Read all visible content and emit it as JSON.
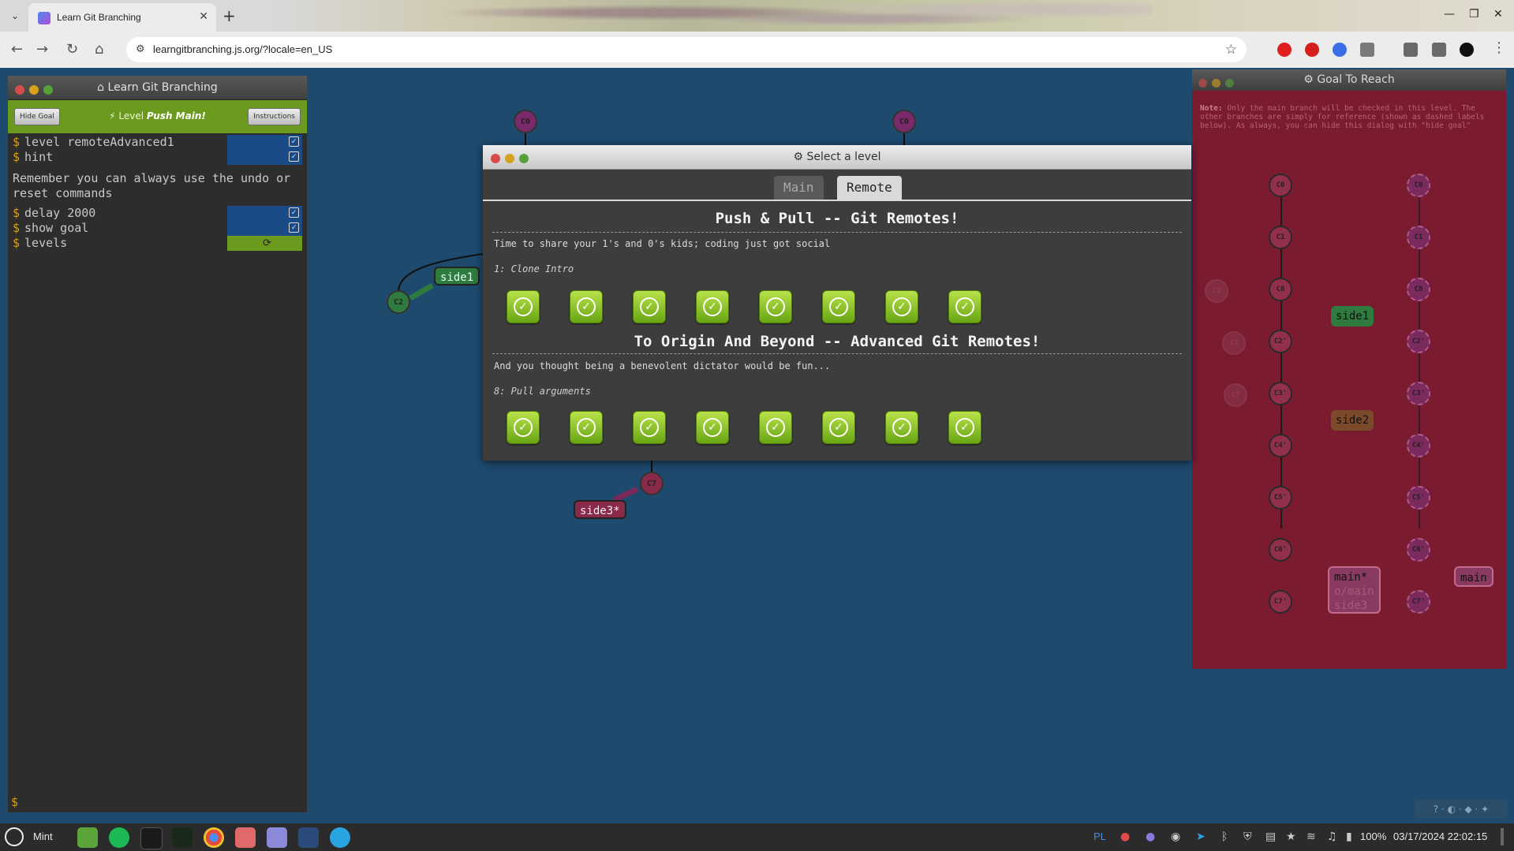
{
  "browser": {
    "tab_title": "Learn Git Branching",
    "tab_close": "✕",
    "new_tab": "+",
    "url": "learngitbranching.js.org/?locale=en_US",
    "nav": {
      "back": "←",
      "forward": "→",
      "reload": "↻",
      "home": "⌂"
    },
    "window": {
      "minimize": "—",
      "restore": "❐",
      "close": "✕"
    }
  },
  "terminal": {
    "title": "Learn Git Branching",
    "hide_goal_label": "Hide Goal",
    "instructions_label": "Instructions",
    "level_prefix": "Level",
    "level_name": "Push Main!",
    "commands": [
      {
        "text": "level remoteAdvanced1",
        "status": "done"
      },
      {
        "text": "hint",
        "status": "done"
      },
      {
        "text": "delay 2000",
        "status": "done"
      },
      {
        "text": "show goal",
        "status": "done"
      },
      {
        "text": "levels",
        "status": "running"
      }
    ],
    "message": "Remember you can always use the undo or reset commands",
    "prompt": "$",
    "dollar": "$",
    "check": "✓",
    "refresh": "⟳"
  },
  "graph": {
    "nodes": [
      {
        "id": "C0",
        "label": "C0"
      },
      {
        "id": "C0b",
        "label": "C0"
      },
      {
        "id": "C2",
        "label": "C2"
      },
      {
        "id": "C7",
        "label": "C7"
      }
    ],
    "branches": {
      "side1": "side1",
      "side3": "side3*"
    }
  },
  "goal": {
    "title": "Goal To Reach",
    "note_label": "Note:",
    "note": "Only the main branch will be checked in this level. The other branches are simply for reference (shown as dashed labels below). As always, you can hide this dialog with \"hide goal\"",
    "left_column": [
      "C0",
      "C1",
      "C8",
      "C2'",
      "C3'",
      "C4'",
      "C5'",
      "C6'",
      "C7'"
    ],
    "right_column": [
      "C0",
      "C1",
      "C8",
      "C2'",
      "C3'",
      "C4'",
      "C5'",
      "C6'",
      "C7'"
    ],
    "ghost_nodes": [
      "C2",
      "C3",
      "C7"
    ],
    "labels": {
      "side1": "side1",
      "side2": "side2",
      "main_star": "main*",
      "o_main": "o/main",
      "side3": "side3",
      "main_right": "main"
    }
  },
  "dialog": {
    "title": "Select a level",
    "tabs": [
      "Main",
      "Remote"
    ],
    "active_tab": "Remote",
    "sections": [
      {
        "title": "Push & Pull -- Git Remotes!",
        "description": "Time to share your 1's and 0's kids; coding just got social",
        "current": "1: Clone Intro",
        "levels_done": 8
      },
      {
        "title": "To Origin And Beyond -- Advanced Git Remotes!",
        "description": "And you thought being a benevolent dictator would be fun...",
        "current": "8: Pull arguments",
        "levels_done": 8
      }
    ],
    "check_glyph": "✓"
  },
  "taskbar": {
    "start_label": "Mint",
    "keyboard_layout": "PL",
    "battery": "100%",
    "datetime": "03/17/2024 22:02:15"
  },
  "colors": {
    "canvas_bg": "#1e4a6e",
    "goal_bg": "#7a1b2f",
    "level_done": "#7fb81f"
  }
}
